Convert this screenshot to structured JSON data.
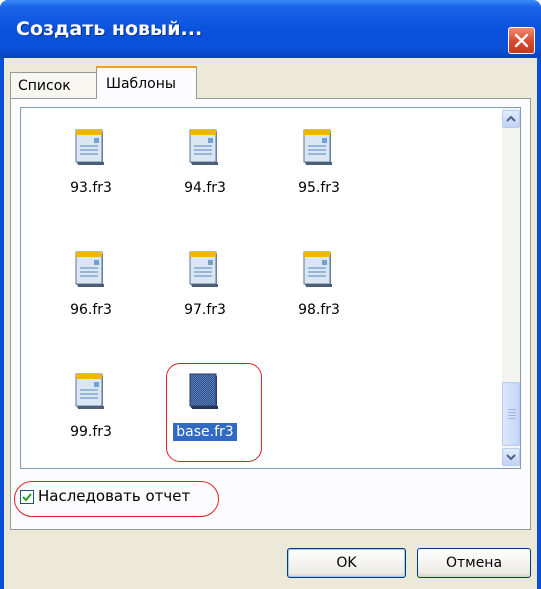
{
  "window": {
    "title": "Создать новый..."
  },
  "tabs": [
    {
      "label": "Список"
    },
    {
      "label": "Шаблоны"
    }
  ],
  "files": [
    {
      "name": "93.fr3"
    },
    {
      "name": "94.fr3"
    },
    {
      "name": "95.fr3"
    },
    {
      "name": "96.fr3"
    },
    {
      "name": "97.fr3"
    },
    {
      "name": "98.fr3"
    },
    {
      "name": "99.fr3"
    },
    {
      "name": "base.fr3"
    }
  ],
  "checkbox": {
    "label": "Наследовать отчет",
    "checked": true
  },
  "buttons": {
    "ok": "OK",
    "cancel": "Отмена"
  },
  "colors": {
    "titlebar": "#0a52dc",
    "selection": "#316ac5",
    "highlight": "#e02020"
  }
}
